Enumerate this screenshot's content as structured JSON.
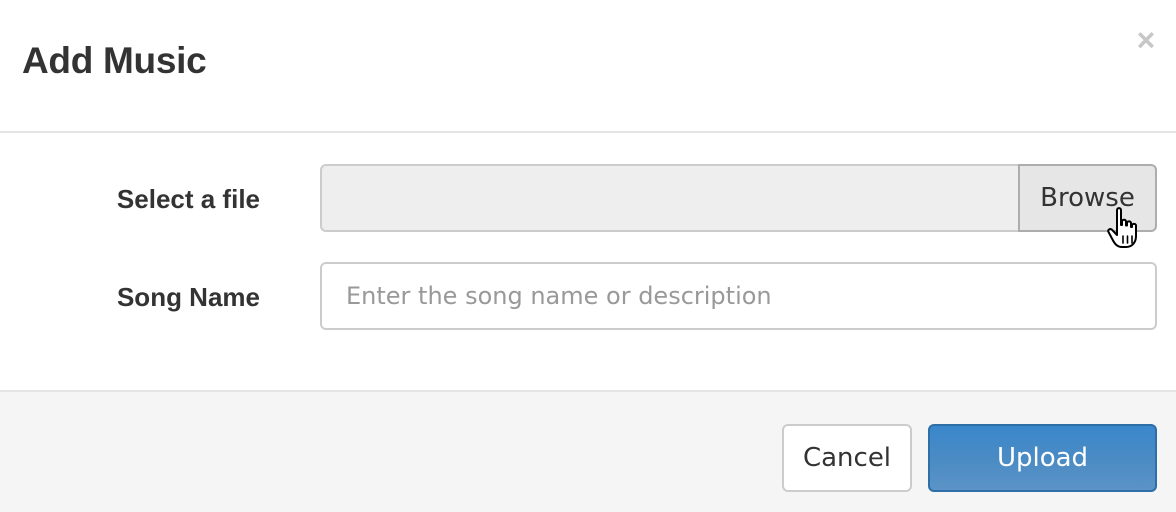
{
  "dialog": {
    "title": "Add Music",
    "close_symbol": "×",
    "close_icon": "close-icon"
  },
  "form": {
    "file_label": "Select a file",
    "file_value": "",
    "browse_label": "Browse",
    "song_label": "Song Name",
    "song_value": "",
    "song_placeholder": "Enter the song name or description"
  },
  "footer": {
    "cancel_label": "Cancel",
    "upload_label": "Upload"
  },
  "cursor": {
    "icon": "hand-pointer-icon"
  },
  "colors": {
    "primary": "#4a8bc4",
    "primary_border": "#2f6fa8",
    "footer_background": "#f5f5f5",
    "file_field_background": "#eeeeee"
  }
}
